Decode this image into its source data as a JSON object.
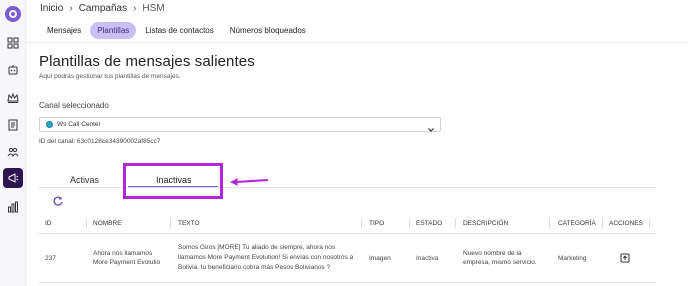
{
  "breadcrumb": {
    "home": "Inicio",
    "section": "Campañas",
    "current": "HSM"
  },
  "tabs": [
    {
      "label": "Mensajes"
    },
    {
      "label": "Plantillas"
    },
    {
      "label": "Listas de contactos"
    },
    {
      "label": "Números bloqueados"
    }
  ],
  "page": {
    "title": "Plantillas de mensajes salientes",
    "subtitle": "Aquí podrás gestionar tus plantillas de mensajes."
  },
  "channel": {
    "label": "Canal seleccionado",
    "selected": "Ws Call Center",
    "id_text": "ID del canal: 63c0128ce34390002af85cc7"
  },
  "status_tabs": {
    "active": "Activas",
    "inactive": "Inactivas",
    "selected": "Inactivas"
  },
  "table": {
    "headers": [
      "ID",
      "NOMBRE",
      "TEXTO",
      "TIPO",
      "ESTADO",
      "DESCRIPCIÓN",
      "CATEGORÍA",
      "ACCIONES"
    ],
    "rows": [
      {
        "id": "237",
        "nombre_1": "Ahora nos llamamos",
        "nombre_2": "More Payment Evolutio",
        "texto_1": "Somos Giros [MORE] Tu aliado de siempre, ahora nos",
        "texto_2": "llamamos More Payment Evolution! Si envías con nosotros a",
        "texto_3": "Bolivia, tu beneficiario cobra más Pesos Bolivianos ?",
        "tipo": "Imagen",
        "estado": "Inactiva",
        "descripcion_1": "Nuevo nombre de la",
        "descripcion_2": "empresa, mismo servicio.",
        "categoria": "Marketing"
      }
    ]
  },
  "colors": {
    "accent": "#7a5bd6",
    "highlight": "#b026d8",
    "tab_selected_bg": "#c9bff3",
    "rail_active": "#2d1650"
  }
}
